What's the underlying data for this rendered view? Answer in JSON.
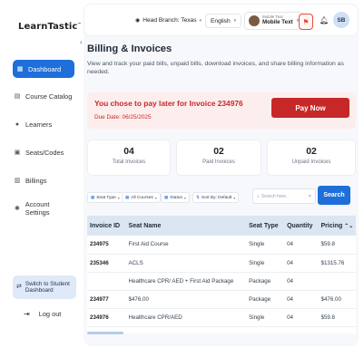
{
  "app": {
    "logo_text": "LearnTastic",
    "logo_mark": "™"
  },
  "sidebar": {
    "items": [
      {
        "label": "Dashboard",
        "icon": "grid-icon",
        "active": true
      },
      {
        "label": "Course Catalog",
        "icon": "book-icon"
      },
      {
        "label": "Learners",
        "icon": "user-icon"
      },
      {
        "label": "Seats/Codes",
        "icon": "ticket-icon"
      },
      {
        "label": "Billings",
        "icon": "receipt-icon"
      },
      {
        "label": "Account Settings",
        "icon": "gear-icon"
      }
    ],
    "switch_label": "Switch to Student Dashboard",
    "logout_label": "Log out"
  },
  "topbar": {
    "branch_label": "Head Branch: Texas",
    "language": "English",
    "mobile_small": "Mobile Text",
    "mobile_main": "Mobile Text",
    "user_initials": "SB"
  },
  "page": {
    "title": "Billing & Invoices",
    "description": "View and track your paid bills, unpaid bills, download invoices, and share billing information as needed."
  },
  "pay_banner": {
    "title": "You chose to pay later for Invoice 234976",
    "due": "Due Date: 06/25/2025",
    "button": "Pay Now"
  },
  "stats": [
    {
      "value": "04",
      "label": "Total Invoices"
    },
    {
      "value": "02",
      "label": "Paid Invoices"
    },
    {
      "value": "02",
      "label": "Unpaid Invoices"
    }
  ],
  "filters": [
    {
      "label": "Seat Type"
    },
    {
      "label": "All Courses"
    },
    {
      "label": "Status"
    },
    {
      "label": "Sort By: Default"
    }
  ],
  "search": {
    "placeholder": "Search here..",
    "button": "Search"
  },
  "table": {
    "headers": [
      "Invoice ID",
      "Seat Name",
      "Seat Type",
      "Quantity",
      "Pricing"
    ],
    "rows": [
      [
        "234975",
        "First Aid Course",
        "Single",
        "04",
        "$59.8"
      ],
      [
        "235346",
        "ACLS",
        "Single",
        "04",
        "$1315.76"
      ],
      [
        "",
        "Healthcare CPR/ AED + First Aid Package",
        "Package",
        "04",
        ""
      ],
      [
        "234977",
        "$476.00",
        "Package",
        "04",
        "$476.00"
      ],
      [
        "234976",
        "Healthcare CPR/AED",
        "Single",
        "04",
        "$59.8"
      ]
    ]
  },
  "colors": {
    "accent": "#1e6fd9",
    "danger": "#c62828",
    "banner_bg": "#fdeeee"
  }
}
